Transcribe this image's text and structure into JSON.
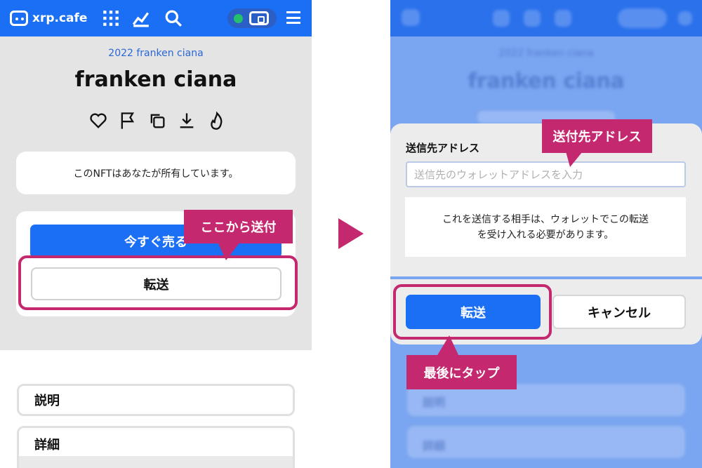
{
  "left": {
    "logo_text": "xrp.cafe",
    "collection_link": "2022 franken ciana",
    "nft_title": "franken ciana",
    "ownership_notice": "このNFTはあなたが所有しています。",
    "sell_button_label": "今すぐ売る",
    "transfer_button_label": "転送",
    "callout_label": "ここから送付",
    "list_items": [
      "説明",
      "詳細"
    ]
  },
  "right": {
    "background_title": "franken ciana",
    "background_collection": "2022 franken ciana",
    "background_list_items": [
      "説明",
      "詳細"
    ],
    "address_label": "送信先アドレス",
    "address_placeholder": "送信先のウォレットアドレスを入力",
    "address_value": "",
    "info_line1": "これを送信する相手は、ウォレットでこの転送",
    "info_line2": "を受け入れる必要があります。",
    "transfer_button_label": "転送",
    "cancel_button_label": "キャンセル",
    "callout_address_label": "送付先アドレス",
    "callout_final_label": "最後にタップ"
  },
  "colors": {
    "brand_blue": "#1a6ff4",
    "callout_magenta": "#c4286f",
    "status_green": "#23c16b"
  },
  "icons": [
    "grid-icon",
    "chart-icon",
    "search-icon",
    "wallet-icon",
    "menu-icon",
    "heart-icon",
    "flag-icon",
    "copy-icon",
    "download-icon",
    "flame-icon"
  ]
}
